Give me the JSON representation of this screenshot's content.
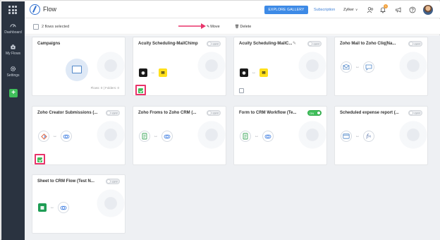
{
  "app": {
    "title": "Flow"
  },
  "header": {
    "explore_label": "EXPLORE GALLERY",
    "subscription_label": "Subscription",
    "org_label": "Zylker",
    "org_chevron": "v",
    "notification_count": "1"
  },
  "sidebar": {
    "items": [
      {
        "label": "Dashboard",
        "icon": "dashboard-icon"
      },
      {
        "label": "My Flows",
        "icon": "my-flows-icon"
      },
      {
        "label": "Settings",
        "icon": "gear-icon"
      }
    ],
    "add_label": "+"
  },
  "toolbar": {
    "selected_label": "2 flows selected",
    "move_label": "Move",
    "delete_label": "Delete"
  },
  "folder": {
    "title": "Campaigns",
    "counts": "Flows: 0  |  Folders: 0"
  },
  "flows": [
    {
      "title": "Acuity Scheduling-MailChimp",
      "status": "OFF",
      "checked": true
    },
    {
      "title": "Acuity Scheduling-MailC...",
      "status": "OFF",
      "checked": false
    },
    {
      "title": "Zoho Mail to Zoho Cliq(Na...",
      "status": "OFF",
      "checked": false
    },
    {
      "title": "Zoho Creator Submissions (...",
      "status": "OFF",
      "checked": true
    },
    {
      "title": "Zoho Froms to Zoho CRM (...",
      "status": "OFF",
      "checked": false
    },
    {
      "title": "Form to CRM Workflow (Te...",
      "status": "ON",
      "checked": false
    },
    {
      "title": "Scheduled expense report (...",
      "status": "OFF",
      "checked": false
    },
    {
      "title": "Sheet to CRM Flow (Test N...",
      "status": "OFF",
      "checked": false
    }
  ],
  "connector_glyph": "↔",
  "colors": {
    "sidebar_bg": "#2a3340",
    "accent_blue": "#3d8ae6",
    "toggle_on": "#3fbf5a",
    "highlight": "#e8336a",
    "content_bg": "#eef0f3"
  }
}
